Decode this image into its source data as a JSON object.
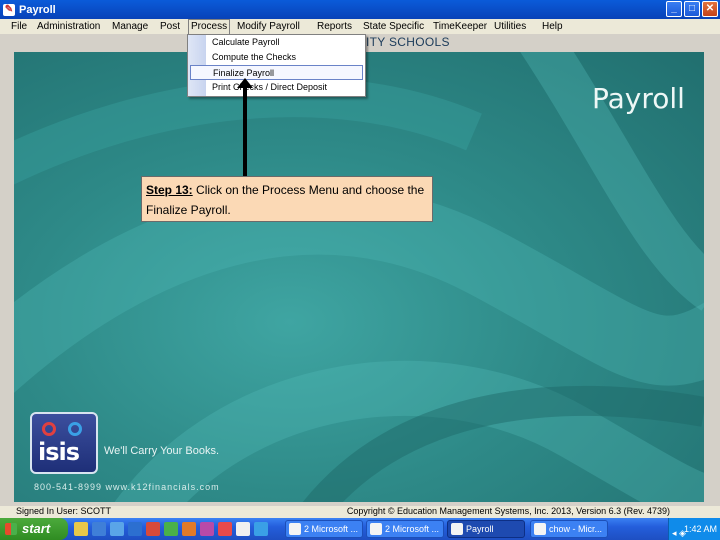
{
  "window": {
    "title": "Payroll",
    "controls": [
      "_",
      "□",
      "✕"
    ]
  },
  "menu": [
    "File",
    "Administration",
    "Manage",
    "Post",
    "Process",
    "Modify Payroll",
    "Reports",
    "State Specific",
    "TimeKeeper",
    "Utilities",
    "Help"
  ],
  "process_menu": {
    "items": [
      "Calculate Payroll",
      "Compute the Checks",
      "Finalize Payroll",
      "Print Checks / Direct Deposit"
    ],
    "highlighted": "Finalize Payroll"
  },
  "content": {
    "school_name": "ITY SCHOOLS",
    "module_title": "Payroll",
    "logo_text": "isis",
    "tagline": "We'll Carry Your Books.",
    "contact": "800-541-8999     www.k12financials.com"
  },
  "callout": {
    "step": "Step 13:",
    "text": " Click on the Process Menu and choose the Finalize Payroll."
  },
  "status": {
    "signed_in": "Signed In User: SCOTT",
    "copyright": "Copyright © Education Management Systems, Inc. 2013, Version 6.3 (Rev. 4739)"
  },
  "taskbar": {
    "start": "start",
    "tasks": [
      "2 Microsoft ...",
      "2 Microsoft ...",
      "Payroll",
      "chow - Micr..."
    ],
    "clock": "1:42 AM"
  },
  "colors": {
    "panel_teal": "#2e8a88",
    "callout_bg": "#fbd9b5",
    "titlebar_blue": "#0842b8"
  }
}
